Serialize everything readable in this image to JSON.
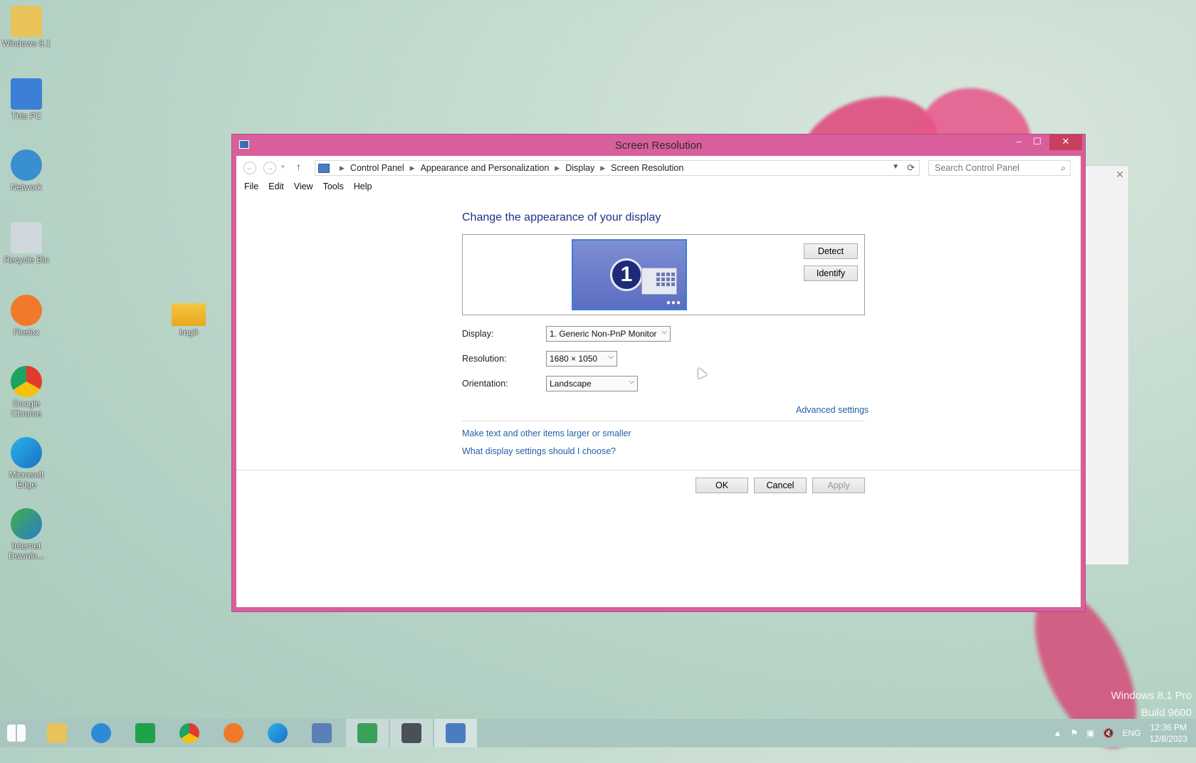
{
  "desktop": {
    "icons": [
      {
        "label": "Windows 8.1"
      },
      {
        "label": "This PC"
      },
      {
        "label": "Network"
      },
      {
        "label": "Recycle Bin"
      },
      {
        "label": "Firefox"
      },
      {
        "label": "Google Chrome"
      },
      {
        "label": "Microsoft Edge"
      },
      {
        "label": "Internet Downlo..."
      },
      {
        "label": "img0"
      }
    ],
    "watermark_line1": "Windows 8.1 Pro",
    "watermark_line2": "Build 9600"
  },
  "window": {
    "title": "Screen Resolution",
    "address": {
      "crumbs": [
        "Control Panel",
        "Appearance and Personalization",
        "Display",
        "Screen Resolution"
      ]
    },
    "search_placeholder": "Search Control Panel",
    "menu": [
      "File",
      "Edit",
      "View",
      "Tools",
      "Help"
    ],
    "heading": "Change the appearance of your display",
    "monitor_number": "1",
    "detect_label": "Detect",
    "identify_label": "Identify",
    "display_label": "Display:",
    "display_value": "1. Generic Non-PnP Monitor",
    "resolution_label": "Resolution:",
    "resolution_value": "1680 × 1050",
    "orientation_label": "Orientation:",
    "orientation_value": "Landscape",
    "advanced_link": "Advanced settings",
    "link_text_size": "Make text and other items larger or smaller",
    "link_which_settings": "What display settings should I choose?",
    "ok_label": "OK",
    "cancel_label": "Cancel",
    "apply_label": "Apply"
  },
  "taskbar": {
    "tray_lang": "ENG",
    "time": "12:36 PM",
    "date": "12/8/2023"
  }
}
